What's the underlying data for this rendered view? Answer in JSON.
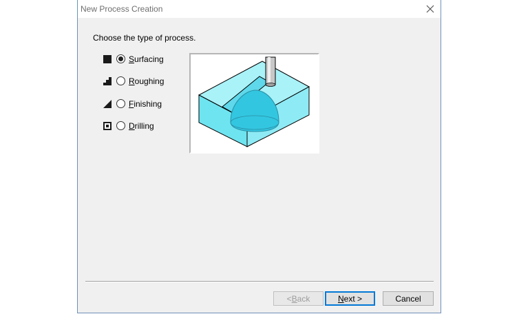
{
  "window": {
    "title": "New Process Creation"
  },
  "prompt": "Choose the type of process.",
  "options": [
    {
      "label_acc": "S",
      "label_rest": "urfacing",
      "checked": true,
      "icon": "filled-square-icon"
    },
    {
      "label_acc": "R",
      "label_rest": "oughing",
      "checked": false,
      "icon": "stair-step-icon"
    },
    {
      "label_acc": "F",
      "label_rest": "inishing",
      "checked": false,
      "icon": "ramp-triangle-icon"
    },
    {
      "label_acc": "D",
      "label_rest": "rilling",
      "checked": false,
      "icon": "hole-square-icon"
    }
  ],
  "buttons": {
    "back_prefix": "< ",
    "back_acc": "B",
    "back_rest": "ack",
    "next_acc": "N",
    "next_rest": "ext >",
    "cancel": "Cancel"
  },
  "colors": {
    "accent": "#0078d7",
    "preview_block": "#7fe8f2",
    "preview_dome": "#33c6e0"
  }
}
